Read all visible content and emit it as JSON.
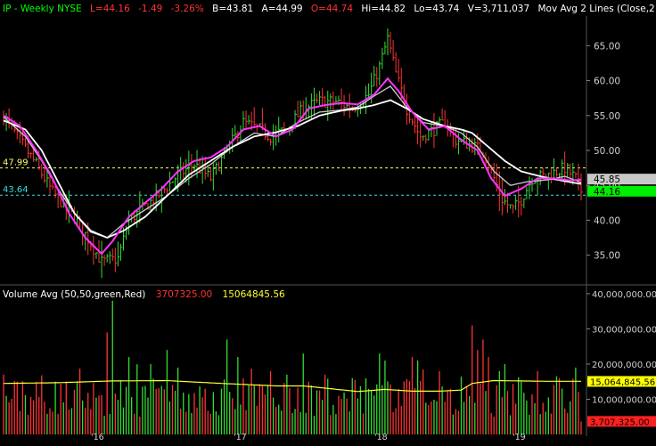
{
  "header": {
    "parts": [
      {
        "text": "IP - Weekly  NYSE",
        "color": "#00ff00"
      },
      {
        "text": "L=44.16",
        "color": "#ff3333"
      },
      {
        "text": "-1.49",
        "color": "#ff3333"
      },
      {
        "text": "-3.26%",
        "color": "#ff3333"
      },
      {
        "text": "B=43.81",
        "color": "#ffffff"
      },
      {
        "text": "A=44.99",
        "color": "#ffffff"
      },
      {
        "text": "O=44.74",
        "color": "#ff3333"
      },
      {
        "text": "Hi=44.82",
        "color": "#ffffff"
      },
      {
        "text": "Lo=43.74",
        "color": "#ffffff"
      },
      {
        "text": "V=3,711,037",
        "color": "#ffffff"
      },
      {
        "text": "Mov Avg 2 Lines (Close,2 ...",
        "color": "#ffffff"
      }
    ]
  },
  "volume_header": {
    "label": "Volume Avg (50,50,green,Red)",
    "value1": "3707325.00",
    "value2": "15064845.56"
  },
  "colors": {
    "up": "#33dd33",
    "down": "#ff3333",
    "ma_fast": "#ff33ff",
    "ma_slow": "#ffffff",
    "ma_mid": "#cccccc",
    "ref_yellow": "#ffff66",
    "ref_cyan": "#33dddd",
    "vol_avg": "#ffff33"
  },
  "chart_data": [
    {
      "type": "candlestick",
      "name": "price",
      "ylim": [
        31,
        69
      ],
      "y_ticks": [
        "65.00",
        "60.00",
        "55.00",
        "50.00",
        "45.00",
        "40.00",
        "35.00"
      ],
      "y_tick_values": [
        65,
        60,
        55,
        50,
        45,
        40,
        35
      ],
      "x_ticks": [
        "'16",
        "'17",
        "'18",
        "'19"
      ],
      "x_tick_positions": [
        36,
        88,
        141,
        192
      ],
      "bars_total": 213,
      "key_points": [
        [
          0,
          55
        ],
        [
          5,
          52
        ],
        [
          12,
          48
        ],
        [
          18,
          44
        ],
        [
          25,
          41
        ],
        [
          30,
          38
        ],
        [
          36,
          34
        ],
        [
          42,
          34.5
        ],
        [
          46,
          40
        ],
        [
          52,
          42
        ],
        [
          58,
          44
        ],
        [
          64,
          46.5
        ],
        [
          70,
          48
        ],
        [
          76,
          46
        ],
        [
          82,
          50
        ],
        [
          88,
          54
        ],
        [
          94,
          53
        ],
        [
          98,
          52
        ],
        [
          104,
          53
        ],
        [
          110,
          56
        ],
        [
          116,
          57
        ],
        [
          122,
          57
        ],
        [
          128,
          56
        ],
        [
          134,
          58
        ],
        [
          138,
          62
        ],
        [
          141,
          66
        ],
        [
          144,
          61
        ],
        [
          148,
          56
        ],
        [
          153,
          52
        ],
        [
          158,
          53
        ],
        [
          162,
          54
        ],
        [
          166,
          51.5
        ],
        [
          170,
          51
        ],
        [
          176,
          50
        ],
        [
          180,
          46
        ],
        [
          183,
          43
        ],
        [
          187,
          41.5
        ],
        [
          190,
          43
        ],
        [
          194,
          46
        ],
        [
          200,
          46.5
        ],
        [
          206,
          47.5
        ],
        [
          210,
          46
        ],
        [
          212,
          44.2
        ]
      ],
      "ma_fast_points": [
        [
          0,
          55
        ],
        [
          6,
          53.5
        ],
        [
          12,
          50
        ],
        [
          18,
          46
        ],
        [
          24,
          41
        ],
        [
          30,
          37.5
        ],
        [
          36,
          35.2
        ],
        [
          40,
          37
        ],
        [
          46,
          40.5
        ],
        [
          52,
          42.5
        ],
        [
          58,
          44.5
        ],
        [
          64,
          47
        ],
        [
          70,
          48.5
        ],
        [
          76,
          49
        ],
        [
          82,
          50.5
        ],
        [
          88,
          53
        ],
        [
          94,
          53.5
        ],
        [
          100,
          52
        ],
        [
          106,
          53
        ],
        [
          112,
          56
        ],
        [
          118,
          56.5
        ],
        [
          124,
          56.8
        ],
        [
          130,
          56.6
        ],
        [
          136,
          58
        ],
        [
          141,
          60.3
        ],
        [
          145,
          58.5
        ],
        [
          150,
          55.5
        ],
        [
          156,
          53
        ],
        [
          162,
          53.5
        ],
        [
          168,
          51.5
        ],
        [
          174,
          50
        ],
        [
          179,
          46
        ],
        [
          184,
          43.5
        ],
        [
          190,
          44.5
        ],
        [
          196,
          46
        ],
        [
          202,
          46
        ],
        [
          208,
          45.7
        ],
        [
          212,
          45.8
        ]
      ],
      "ma_slow_points": [
        [
          0,
          54.3
        ],
        [
          8,
          53
        ],
        [
          14,
          50
        ],
        [
          20,
          45.5
        ],
        [
          26,
          41
        ],
        [
          32,
          38.5
        ],
        [
          38,
          37.5
        ],
        [
          44,
          38.5
        ],
        [
          52,
          40.5
        ],
        [
          60,
          43.5
        ],
        [
          68,
          46.5
        ],
        [
          76,
          48.5
        ],
        [
          84,
          50.5
        ],
        [
          92,
          52
        ],
        [
          100,
          52.6
        ],
        [
          108,
          53.5
        ],
        [
          116,
          55
        ],
        [
          124,
          55.7
        ],
        [
          130,
          56
        ],
        [
          136,
          56.5
        ],
        [
          142,
          57.2
        ],
        [
          148,
          56
        ],
        [
          154,
          54.5
        ],
        [
          162,
          53.5
        ],
        [
          168,
          53
        ],
        [
          172,
          52.5
        ],
        [
          178,
          50.5
        ],
        [
          184,
          48.5
        ],
        [
          190,
          47
        ],
        [
          198,
          46.2
        ],
        [
          206,
          45.6
        ],
        [
          212,
          45.2
        ]
      ],
      "ma_mid_points": [
        [
          0,
          54.8
        ],
        [
          8,
          52
        ],
        [
          14,
          48.5
        ],
        [
          20,
          44.5
        ],
        [
          26,
          41
        ],
        [
          32,
          38.3
        ],
        [
          38,
          37.5
        ],
        [
          44,
          39.5
        ],
        [
          52,
          41.5
        ],
        [
          60,
          43.5
        ],
        [
          68,
          46
        ],
        [
          76,
          48
        ],
        [
          84,
          50.5
        ],
        [
          92,
          52.5
        ],
        [
          100,
          52
        ],
        [
          108,
          54
        ],
        [
          116,
          55.5
        ],
        [
          124,
          55.8
        ],
        [
          130,
          56.2
        ],
        [
          136,
          57.8
        ],
        [
          142,
          59.2
        ],
        [
          148,
          56.2
        ],
        [
          154,
          54
        ],
        [
          162,
          53.5
        ],
        [
          168,
          52.5
        ],
        [
          174,
          50.5
        ],
        [
          180,
          47
        ],
        [
          186,
          45
        ],
        [
          192,
          45.5
        ],
        [
          200,
          45.8
        ],
        [
          206,
          46.3
        ],
        [
          212,
          45.4
        ]
      ],
      "ref_lines": [
        {
          "name": "yellow-ref",
          "value": 47.5,
          "label": "47.99"
        },
        {
          "name": "cyan-ref",
          "value": 43.6,
          "label": "43.64"
        }
      ],
      "right_labels": [
        {
          "name": "ma-value-label",
          "value": 45.9,
          "text": "45.85",
          "bg": "#c8c8c8",
          "fg": "#000000"
        },
        {
          "name": "last-price-label",
          "value": 44.16,
          "text": "44.16",
          "bg": "#00ee00",
          "fg": "#000000"
        }
      ]
    },
    {
      "type": "bar",
      "name": "volume",
      "ylim": [
        0,
        42000000
      ],
      "y_ticks": [
        "40,000,000.00",
        "30,000,000.00",
        "20,000,000.00",
        "10,000,000.00"
      ],
      "y_tick_values": [
        40000000,
        30000000,
        20000000,
        10000000
      ],
      "avg_points": [
        [
          0,
          14.5
        ],
        [
          20,
          14.7
        ],
        [
          40,
          15.2
        ],
        [
          60,
          15.3
        ],
        [
          80,
          14.5
        ],
        [
          100,
          13.8
        ],
        [
          110,
          13.8
        ],
        [
          120,
          13.0
        ],
        [
          130,
          12.2
        ],
        [
          140,
          12.8
        ],
        [
          150,
          12.3
        ],
        [
          160,
          12.3
        ],
        [
          168,
          12.6
        ],
        [
          172,
          14.5
        ],
        [
          180,
          15.3
        ],
        [
          190,
          15.2
        ],
        [
          200,
          15.1
        ],
        [
          212,
          15.1
        ]
      ],
      "spikes": [
        [
          40,
          38
        ],
        [
          38,
          29
        ],
        [
          46,
          22
        ],
        [
          54,
          20
        ],
        [
          60,
          24
        ],
        [
          64,
          19
        ],
        [
          82,
          27
        ],
        [
          86,
          22
        ],
        [
          98,
          18
        ],
        [
          104,
          17
        ],
        [
          110,
          23
        ],
        [
          118,
          17
        ],
        [
          128,
          16
        ],
        [
          138,
          23
        ],
        [
          140,
          21
        ],
        [
          150,
          22
        ],
        [
          152,
          21
        ],
        [
          160,
          18
        ],
        [
          172,
          31
        ],
        [
          174,
          24
        ],
        [
          176,
          27
        ],
        [
          178,
          22
        ],
        [
          182,
          18
        ],
        [
          184,
          20
        ],
        [
          196,
          18
        ],
        [
          204,
          16
        ],
        [
          210,
          19
        ]
      ],
      "right_labels": [
        {
          "name": "vol-avg-label",
          "value": 15064845,
          "text": "15,064,845.56",
          "bg": "#ffff00",
          "fg": "#000000"
        },
        {
          "name": "vol-last-label",
          "value": 3707325,
          "text": "3,707,325.00",
          "bg": "#ff2020",
          "fg": "#000000"
        }
      ]
    }
  ]
}
